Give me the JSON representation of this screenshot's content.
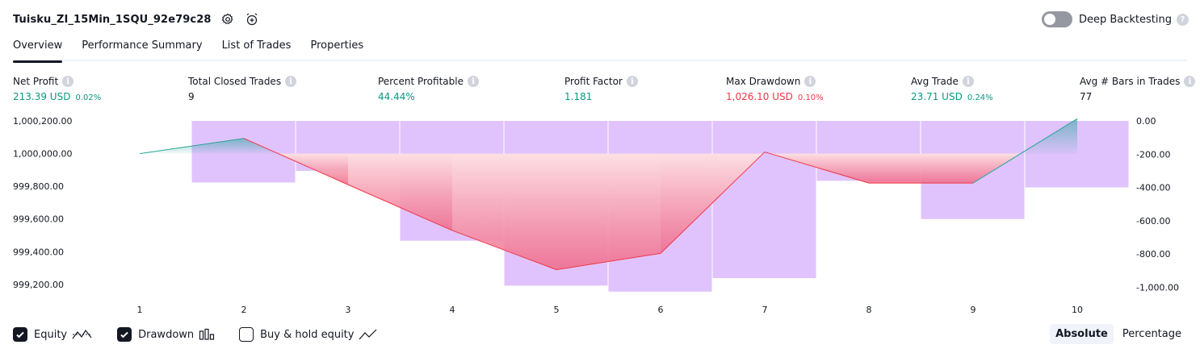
{
  "header": {
    "strategy_title": "Tuisku_ZI_15Min_1SQU_92e79c28",
    "settings_icon": "gear-icon",
    "alert_icon": "alarm-clock-add-icon"
  },
  "deep_backtesting": {
    "label": "Deep Backtesting",
    "enabled": false,
    "help_icon": "?"
  },
  "tabs": [
    {
      "label": "Overview",
      "active": true
    },
    {
      "label": "Performance Summary",
      "active": false
    },
    {
      "label": "List of Trades",
      "active": false
    },
    {
      "label": "Properties",
      "active": false
    }
  ],
  "metrics": {
    "net_profit": {
      "label": "Net Profit",
      "value": "213.39 USD",
      "pct": "0.02%"
    },
    "total_closed_trades": {
      "label": "Total Closed Trades",
      "value": "9"
    },
    "percent_profitable": {
      "label": "Percent Profitable",
      "value": "44.44%"
    },
    "profit_factor": {
      "label": "Profit Factor",
      "value": "1.181"
    },
    "max_drawdown": {
      "label": "Max Drawdown",
      "value": "1,026.10 USD",
      "pct": "0.10%"
    },
    "avg_trade": {
      "label": "Avg Trade",
      "value": "23.71 USD",
      "pct": "0.24%"
    },
    "avg_bars": {
      "label": "Avg # Bars in Trades",
      "value": "77"
    }
  },
  "colors": {
    "profit": "#089981",
    "loss": "#f23645",
    "drawdown_bar": "#e0c3fc",
    "equity_up": "#26a69a",
    "equity_down": "#f23645",
    "text": "#131722"
  },
  "chart_data": {
    "type": "line",
    "x": [
      1,
      2,
      3,
      4,
      5,
      6,
      7,
      8,
      9,
      10
    ],
    "series": [
      {
        "name": "Equity",
        "axis": "left",
        "values": [
          1000000.0,
          1000093.0,
          999810.0,
          999530.0,
          999290.0,
          999390.0,
          1000010.0,
          999820.0,
          999820.0,
          1000213.39
        ]
      },
      {
        "name": "Drawdown",
        "type": "bar",
        "axis": "right",
        "values": [
          -370,
          -300,
          -720,
          -990,
          -1026.1,
          -945,
          -360,
          -590,
          -400
        ]
      }
    ],
    "left_axis": {
      "ticks": [
        "1,000,200.00",
        "1,000,000.00",
        "999,800.00",
        "999,600.00",
        "999,400.00",
        "999,200.00"
      ],
      "range": [
        999165.0,
        1000200.0
      ]
    },
    "right_axis": {
      "ticks": [
        "0.00",
        "-200.00",
        "-400.00",
        "-600.00",
        "-800.00",
        "-1,000.00"
      ],
      "range": [
        -1017.0,
        0
      ]
    },
    "x_ticks": [
      "1",
      "2",
      "3",
      "4",
      "5",
      "6",
      "7",
      "8",
      "9",
      "10"
    ]
  },
  "legend": [
    {
      "label": "Equity",
      "checked": true,
      "icon": "equity-line-icon"
    },
    {
      "label": "Drawdown",
      "checked": true,
      "icon": "drawdown-bars-icon"
    },
    {
      "label": "Buy & hold equity",
      "checked": false,
      "icon": "buy-hold-line-icon"
    }
  ],
  "mode_toggle": {
    "absolute_label": "Absolute",
    "percentage_label": "Percentage",
    "selected": "Absolute"
  }
}
